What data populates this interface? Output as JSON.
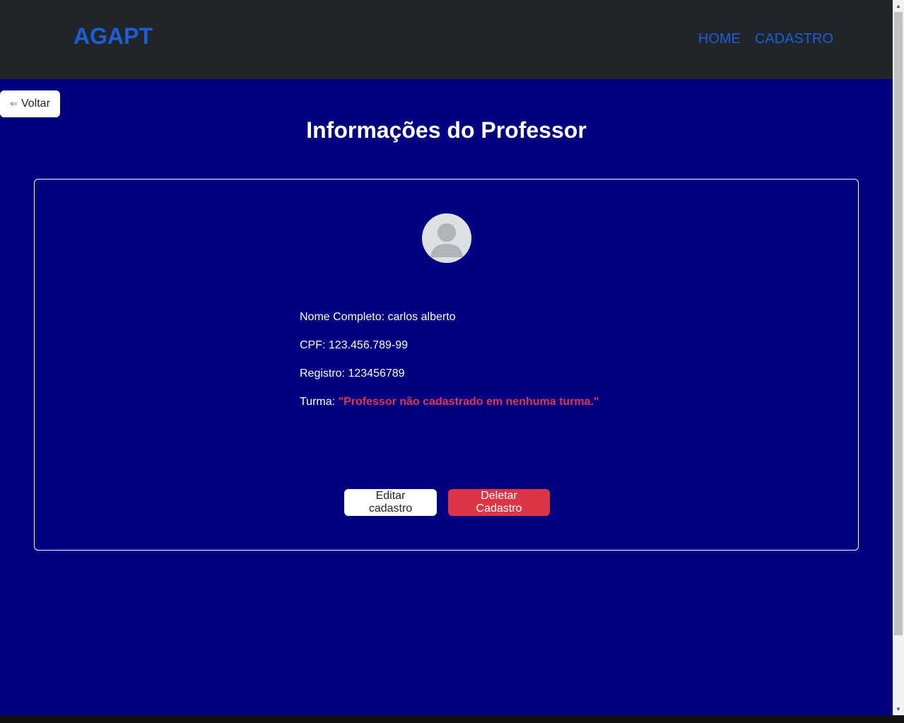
{
  "navbar": {
    "brand": "AGAPT",
    "links": [
      {
        "label": "HOME"
      },
      {
        "label": "CADASTRO"
      }
    ]
  },
  "back_button": {
    "icon": "⇐",
    "label": "Voltar"
  },
  "page_title": "Informações do Professor",
  "avatar_icon": "user-avatar-icon",
  "info": {
    "nome_label": "Nome Completo: ",
    "nome_value": "carlos alberto",
    "cpf_label": "CPF: ",
    "cpf_value": "123.456.789-99",
    "registro_label": "Registro: ",
    "registro_value": "123456789",
    "turma_label": "Turma: ",
    "turma_value": "\"Professor não cadastrado em nenhuma turma.\""
  },
  "actions": {
    "edit_label": "Editar cadastro",
    "delete_label": "Deletar Cadastro"
  },
  "colors": {
    "background": "#000080",
    "navbar": "#212529",
    "brand": "#1a5fd6",
    "danger": "#dc3545"
  }
}
